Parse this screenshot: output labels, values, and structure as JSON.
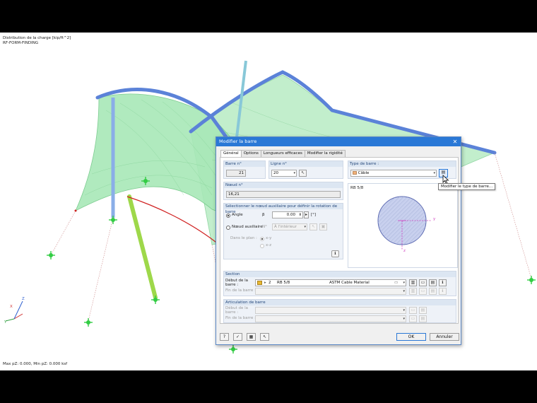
{
  "viewport": {
    "info_line1": "Distribution de la charge [kip/ft^2]",
    "info_line2": "RF-FORM-FINDING",
    "status": "Max pZ: 0.000, Min pZ: 0.000 ksf",
    "axes": {
      "x": "X",
      "y": "Y",
      "z": "Z"
    }
  },
  "dialog": {
    "title": "Modifier la barre",
    "close_symbol": "✕",
    "tabs": [
      "Général",
      "Options",
      "Longueurs efficaces",
      "Modifier la rigidité"
    ],
    "active_tab": "Général",
    "member_no": {
      "label": "Barre n°",
      "value": "21"
    },
    "line_no": {
      "label": "Ligne n°",
      "value": "20"
    },
    "member_type": {
      "label": "Type de barre :",
      "value": "Câble",
      "swatch_color": "#f2b27a"
    },
    "node": {
      "label": "Nœud n°",
      "value": "16,21"
    },
    "rotation": {
      "title": "Sélectionner le nœud auxiliaire pour définir la rotation de barre",
      "angle_label": "Angle",
      "beta_symbol": "β",
      "angle_value": "0.00",
      "angle_unit": "[°]",
      "aux_node_label": "Nœud auxiliaire",
      "aux_node_no": "N°",
      "aux_node_value": "À l'intérieur",
      "plane_label": "Dans le plan :",
      "plane_options": [
        "x-y",
        "x-z"
      ]
    },
    "preview": {
      "label": "RB 5/8",
      "axis_y": "y",
      "axis_z": "z"
    },
    "tooltip": "Modifier le type de barre...",
    "section": {
      "title": "Section",
      "start_label": "Début de la barre :",
      "start_no": "2",
      "start_name": "RB 5/8",
      "start_material": "ASTM Cable Material",
      "end_label": "Fin de la barre :",
      "swatch_color": "#e8b830"
    },
    "hinge": {
      "title": "Articulation de barre",
      "start_label": "Début de la barre :",
      "end_label": "Fin de la barre :"
    },
    "ok_label": "OK",
    "cancel_label": "Annuler"
  }
}
